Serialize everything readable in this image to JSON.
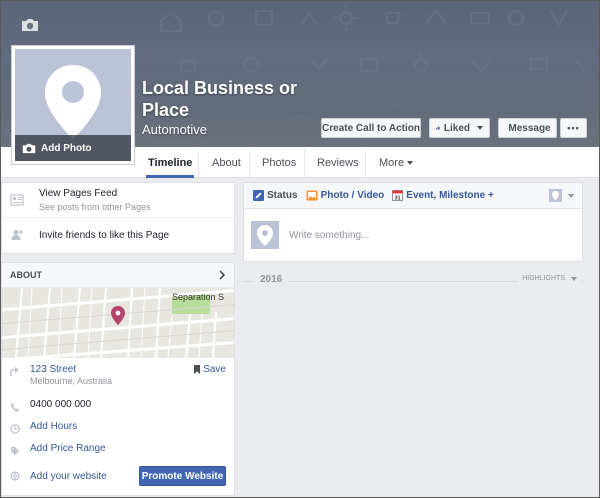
{
  "page": {
    "name": "Local Business or Place",
    "category": "Automotive"
  },
  "profile": {
    "add_photo_label": "Add Photo"
  },
  "actions": {
    "cta_label": "Create Call to Action",
    "liked_label": "Liked",
    "message_label": "Message",
    "more_label": "•••"
  },
  "nav": {
    "tabs": [
      {
        "label": "Timeline",
        "active": true
      },
      {
        "label": "About"
      },
      {
        "label": "Photos"
      },
      {
        "label": "Reviews"
      },
      {
        "label": "More"
      }
    ]
  },
  "sidebar": {
    "feed_title": "View Pages Feed",
    "feed_sub": "See posts from other Pages",
    "invite_label": "Invite friends to like this Page"
  },
  "about": {
    "heading": "ABOUT",
    "map_street_label": "Separation S",
    "address_line1": "123 Street",
    "address_line2": "Melbourne, Australia",
    "save_label": "Save",
    "phone": "0400 000 000",
    "add_hours": "Add Hours",
    "add_price_range": "Add Price Range",
    "add_website": "Add your website",
    "promote_label": "Promote Website"
  },
  "composer": {
    "tab_status": "Status",
    "tab_photo": "Photo / Video",
    "tab_event": "Event, Milestone +",
    "placeholder": "Write something..."
  },
  "timeline": {
    "year": "2016",
    "highlights_label": "HIGHLIGHTS"
  },
  "colors": {
    "accent": "#4267b2",
    "link": "#365899",
    "map_pin": "#b5446d",
    "map_park": "#b8dc9a"
  }
}
